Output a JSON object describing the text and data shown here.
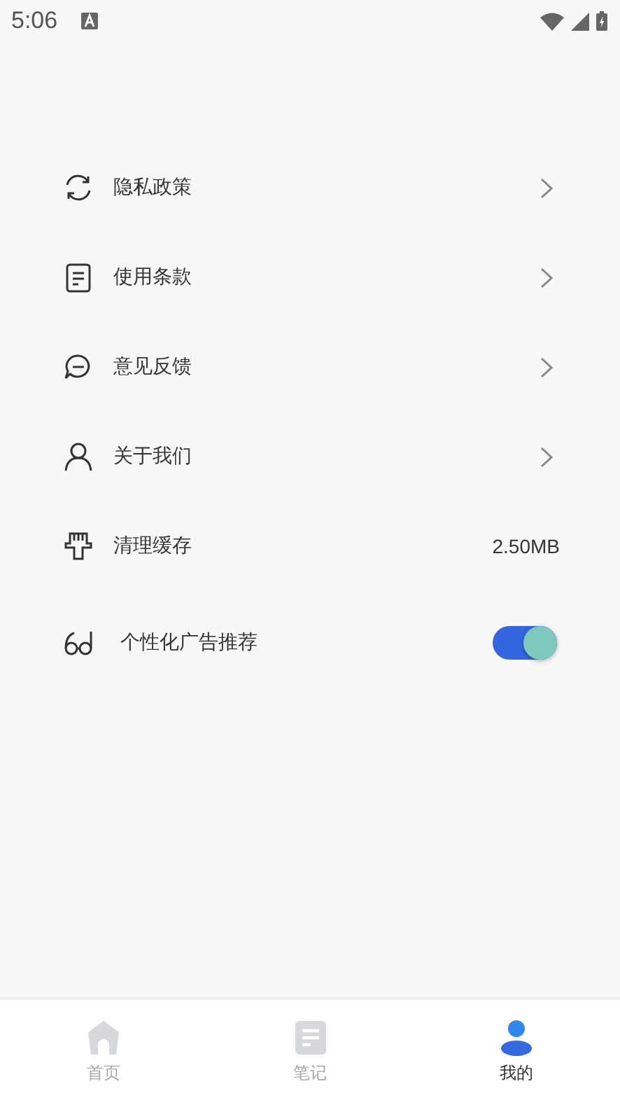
{
  "status_bar": {
    "time": "5:06"
  },
  "settings": [
    {
      "kind": "link",
      "label": "隐私政策"
    },
    {
      "kind": "link",
      "label": "使用条款"
    },
    {
      "kind": "link",
      "label": "意见反馈"
    },
    {
      "kind": "link",
      "label": "关于我们"
    },
    {
      "kind": "value",
      "label": "清理缓存",
      "value": "2.50MB"
    },
    {
      "kind": "toggle",
      "label": "个性化广告推荐",
      "on": true
    }
  ],
  "bottom_nav": [
    {
      "label": "首页",
      "selected": false
    },
    {
      "label": "笔记",
      "selected": false
    },
    {
      "label": "我的",
      "selected": true
    }
  ]
}
